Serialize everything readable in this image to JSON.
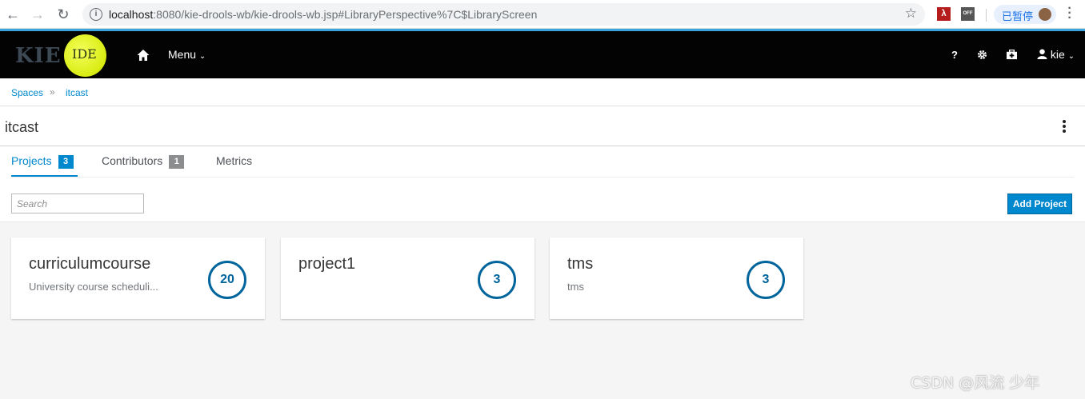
{
  "browser": {
    "url_host": "localhost",
    "url_rest": ":8080/kie-drools-wb/kie-drools-wb.jsp#LibraryPerspective%7C$LibraryScreen",
    "paused_label": "已暂停",
    "ext_off_label": "OFF"
  },
  "header": {
    "logo_text": "KIE",
    "ide_text": "IDE",
    "menu_label": "Menu",
    "help_label": "?",
    "user_label": "kie"
  },
  "breadcrumb": {
    "root": "Spaces",
    "separator": "»",
    "current": "itcast"
  },
  "page": {
    "title": "itcast"
  },
  "tabs": [
    {
      "label": "Projects",
      "count": "3"
    },
    {
      "label": "Contributors",
      "count": "1"
    },
    {
      "label": "Metrics"
    }
  ],
  "toolbar": {
    "search_placeholder": "Search",
    "add_project_label": "Add Project"
  },
  "projects": [
    {
      "name": "curriculumcourse",
      "description": "University course scheduli...",
      "count": "20"
    },
    {
      "name": "project1",
      "description": "",
      "count": "3"
    },
    {
      "name": "tms",
      "description": "tms",
      "count": "3"
    }
  ],
  "colors": {
    "accent": "#0088ce",
    "count_ring": "#00659c",
    "header_bg": "#030303"
  },
  "watermark": "CSDN @风流 少年"
}
